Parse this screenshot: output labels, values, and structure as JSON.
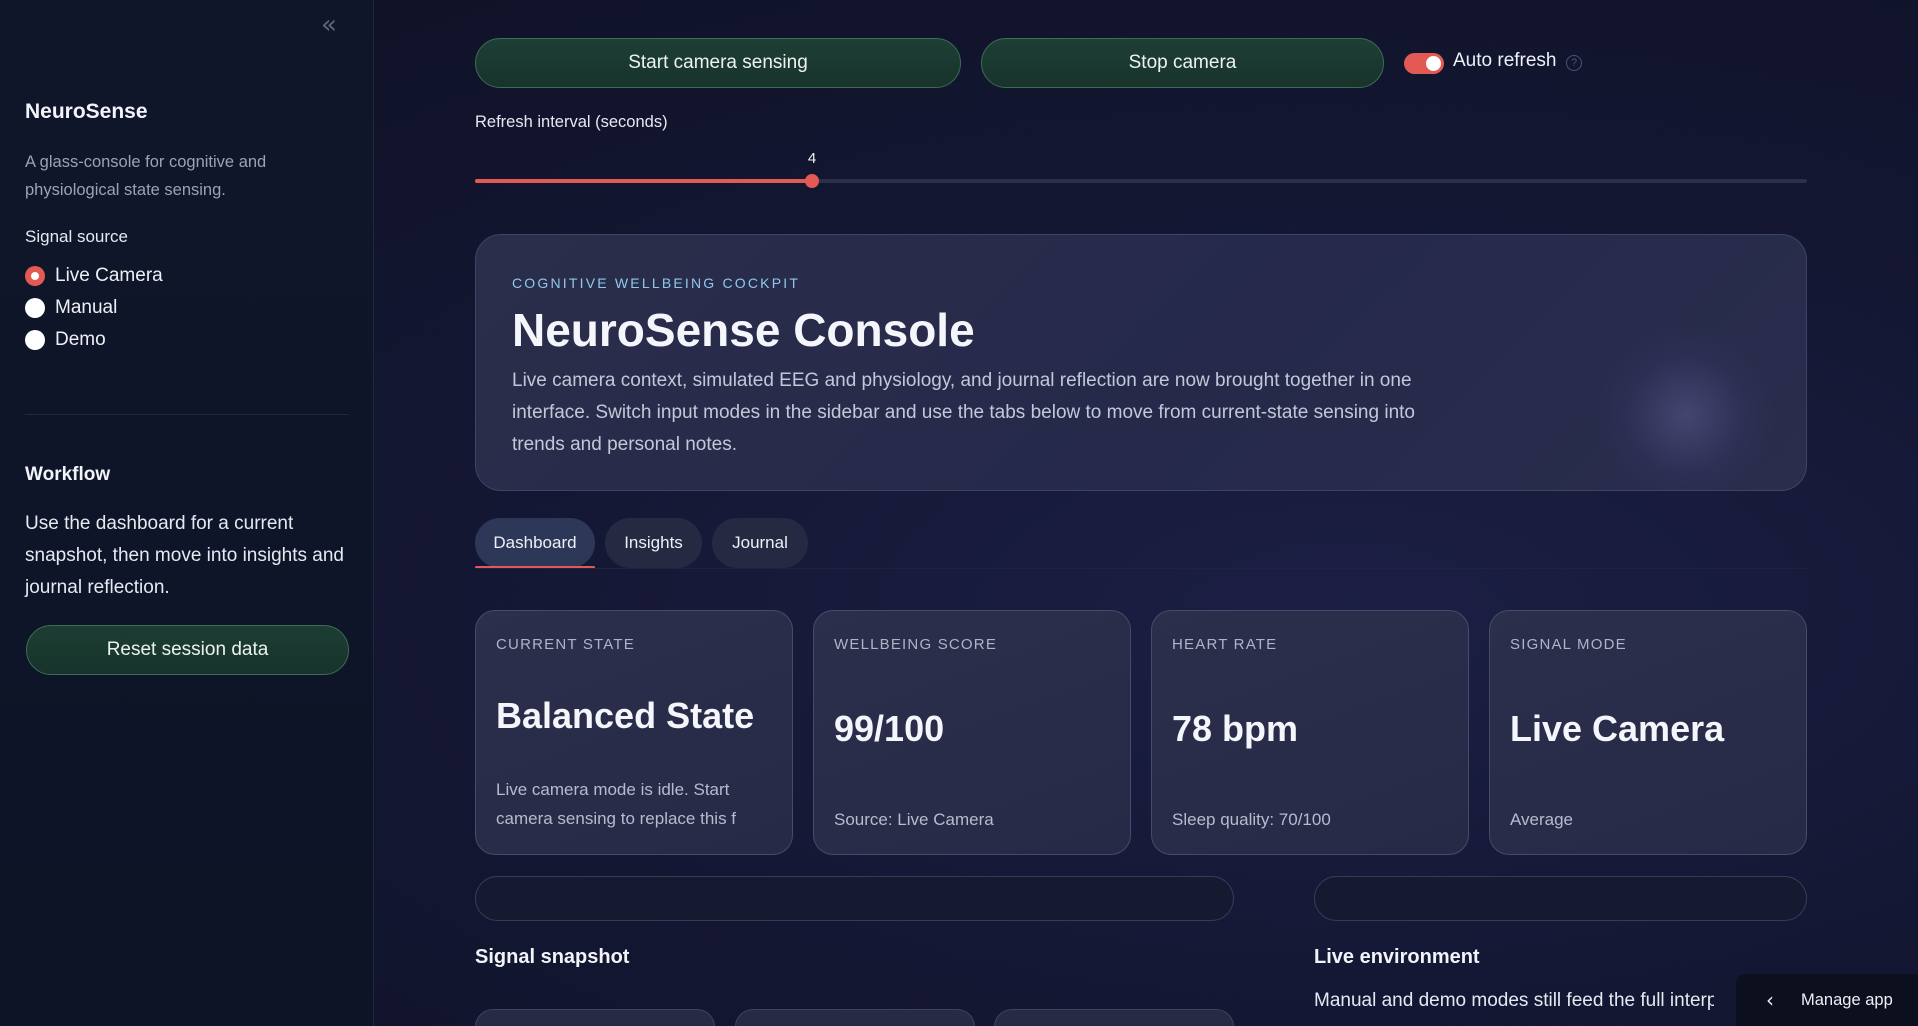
{
  "sidebar": {
    "collapse_icon": "double-chevron-left",
    "brand": "NeuroSense",
    "description": "A glass-console for cognitive and physiological state sensing.",
    "signal_source_label": "Signal source",
    "signal_options": [
      {
        "label": "Live Camera",
        "selected": true
      },
      {
        "label": "Manual",
        "selected": false
      },
      {
        "label": "Demo",
        "selected": false
      }
    ],
    "workflow_title": "Workflow",
    "workflow_text": "Use the dashboard for a current snapshot, then move into insights and journal reflection.",
    "reset_label": "Reset session data"
  },
  "controls": {
    "start_label": "Start camera sensing",
    "stop_label": "Stop camera",
    "auto_refresh_label": "Auto refresh",
    "auto_refresh_on": true,
    "help_icon": "question-circle",
    "interval_label": "Refresh interval (seconds)",
    "interval_value": "4",
    "interval_fraction": 0.253
  },
  "hero": {
    "kicker": "COGNITIVE WELLBEING COCKPIT",
    "title": "NeuroSense Console",
    "text": "Live camera context, simulated EEG and physiology, and journal reflection are now brought together in one interface. Switch input modes in the sidebar and use the tabs below to move from current-state sensing into trends and personal notes."
  },
  "tabs": [
    {
      "label": "Dashboard",
      "active": true
    },
    {
      "label": "Insights",
      "active": false
    },
    {
      "label": "Journal",
      "active": false
    }
  ],
  "cards": [
    {
      "label": "CURRENT STATE",
      "value": "Balanced State",
      "sub": "Live camera mode is idle. Start camera sensing to replace this f"
    },
    {
      "label": "WELLBEING SCORE",
      "value": "99/100",
      "sub": "Source: Live Camera"
    },
    {
      "label": "HEART RATE",
      "value": "78 bpm",
      "sub": "Sleep quality: 70/100"
    },
    {
      "label": "SIGNAL MODE",
      "value": "Live Camera",
      "sub": "Average"
    }
  ],
  "sections": {
    "signal_snapshot": "Signal snapshot",
    "live_environment": "Live environment",
    "live_environment_text": "Manual and demo modes still feed the full interpret"
  },
  "manage_app": {
    "label": "Manage app",
    "icon": "chevron-left"
  },
  "colors": {
    "accent": "#e35a55",
    "button_green": "#1e3f35",
    "kicker_blue": "#8fc8ee"
  }
}
